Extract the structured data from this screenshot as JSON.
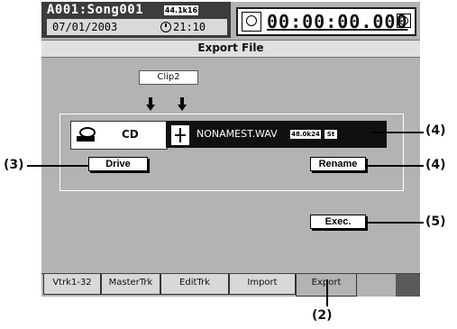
{
  "header": {
    "song": "A001:Song001",
    "format_badge": "44.1k16",
    "date": "07/01/2003",
    "clock_icon": "clock-icon",
    "clock_time": "21:10",
    "timecode": "00:00:00.000",
    "timecode_icon": "clock-icon",
    "alarm_icon": "alarm-clock-icon"
  },
  "title": "Export File",
  "clip_name": "Clip2",
  "drive": {
    "icon": "cd-drive-icon",
    "label": "CD"
  },
  "file": {
    "icon": "wave-file-icon",
    "name": "NONAMEST.WAV",
    "rate_badge": "48.0k24",
    "channel_badge": "St"
  },
  "buttons": {
    "drive": "Drive",
    "rename": "Rename",
    "exec": "Exec."
  },
  "tabs": [
    {
      "label": "Vtrk1-32"
    },
    {
      "label": "MasterTrk"
    },
    {
      "label": "EditTrk"
    },
    {
      "label": "Import"
    },
    {
      "label": "Export",
      "active": true
    }
  ],
  "callouts": {
    "drive_button": "(3)",
    "file": "(4)",
    "rename_button": "(4)",
    "exec_button": "(5)",
    "export_tab": "(2)"
  }
}
